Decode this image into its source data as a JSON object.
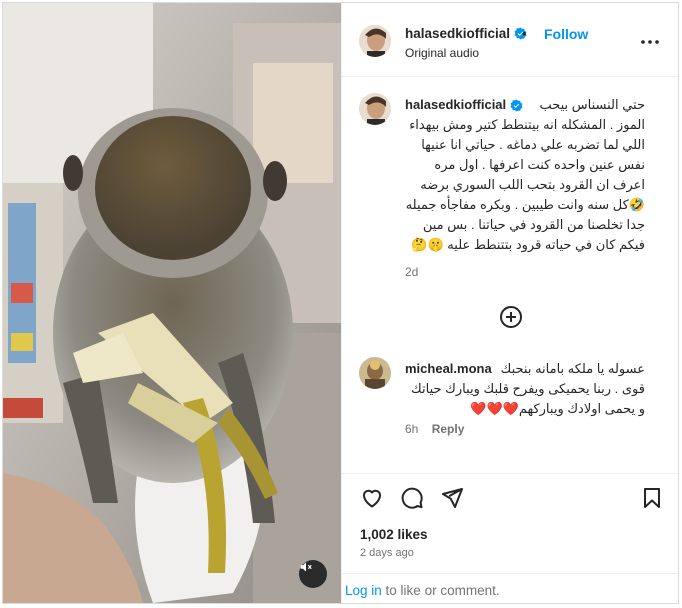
{
  "post": {
    "username": "halasedkiofficial",
    "follow_label": "Follow",
    "separator": "•",
    "audio_label": "Original audio",
    "caption": "حتي النسناس بيحب الموز . المشكله انه بيتنطط كتير ومش بيهداء اللي لما تضربه علي دماغه . حياتي انا عنيها نفس عنين واحده كنت اعرفها . اول مره اعرف ان القرود بتحب اللب السوري برضه 🤣كل سنه وانت طيبين . وبكره مفاجأه جميله جدا تخلصنا من القرود في حياتنا . بس مين فيكم كان في حياته قرود بتتنطط عليه 🤫🤔",
    "caption_time": "2d",
    "likes": "1,002 likes",
    "posted_ago": "2 days ago"
  },
  "comment": {
    "username": "micheal.mona",
    "text": "عسوله يا ملكه بامانه بنحبك قوى . ربنا يحميكى ويفرح قلبك ويبارك حياتك و يحمى اولادك ويباركهم❤️❤️❤️",
    "time": "6h",
    "reply_label": "Reply"
  },
  "footer": {
    "login_label": "Log in",
    "login_suffix": " to like or comment."
  },
  "icons": {
    "header_more": "more-horizontal-icon",
    "verified": "verified-badge-icon",
    "load_more": "plus-circle-icon",
    "like": "heart-icon",
    "comment": "comment-icon",
    "share": "share-icon",
    "save": "bookmark-icon",
    "mute": "muted-speaker-icon"
  },
  "colors": {
    "link_blue": "#0095f6",
    "verified_blue": "#0095f6",
    "muted_text": "#737373",
    "heart_red": "#ed4956"
  }
}
